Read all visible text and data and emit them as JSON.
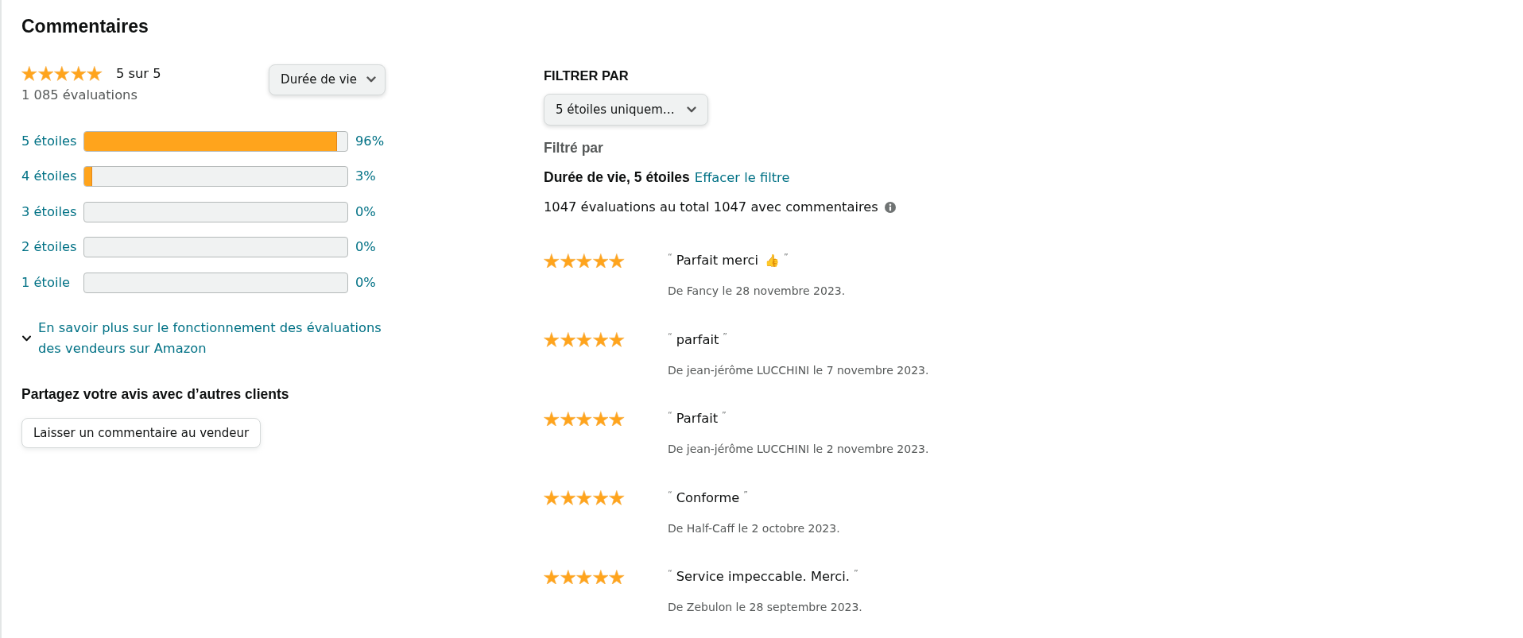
{
  "heading": "Commentaires",
  "summary": {
    "stars": 5,
    "rating": "5 sur 5",
    "count": "1 085 évaluations",
    "period": "Durée de vie"
  },
  "histogram": [
    {
      "label": "5 étoiles",
      "level": 0.96,
      "percent": "96%"
    },
    {
      "label": "4 étoiles",
      "level": 0.03,
      "percent": "3%"
    },
    {
      "label": "3 étoiles",
      "level": 0,
      "percent": "0%"
    },
    {
      "label": "2 étoiles",
      "level": 0,
      "percent": "0%"
    },
    {
      "label": "1 étoile",
      "level": 0,
      "percent": "0%"
    }
  ],
  "learn_more": {
    "text": "En savoir plus sur le fonctionnement des évaluations des vendeurs sur Amazon",
    "expanded": false
  },
  "share": {
    "heading": "Partagez votre avis avec d’autres clients",
    "button": "Laisser un commentaire au vendeur"
  },
  "filter": {
    "heading": "FILTRER PAR",
    "dropdown": "5 étoiles uniquem…",
    "filtered_label": "Filtré par",
    "active": "Durée de vie, 5 étoiles",
    "clear_link": "Effacer le filtre",
    "totals": "1047 évaluations au total 1047 avec commentaires"
  },
  "reviews": [
    {
      "stars": 5,
      "quote_open": "“",
      "title": "Parfait merci",
      "emoji": "👍",
      "quote_close": "”",
      "byline": "De Fancy le 28 novembre 2023."
    },
    {
      "stars": 5,
      "quote_open": "“",
      "title": "parfait",
      "quote_close": "”",
      "byline": "De jean-jérôme LUCCHINI le 7 novembre 2023."
    },
    {
      "stars": 5,
      "quote_open": "“",
      "title": "Parfait",
      "quote_close": "”",
      "byline": "De jean-jérôme LUCCHINI le 2 novembre 2023."
    },
    {
      "stars": 5,
      "quote_open": "“",
      "title": "Conforme",
      "quote_close": "”",
      "byline": "De Half-Caff le 2 octobre 2023."
    },
    {
      "stars": 5,
      "quote_open": "“",
      "title": "Service impeccable. Merci.",
      "quote_close": "”",
      "byline": "De Zebulon le 28 septembre 2023."
    }
  ]
}
